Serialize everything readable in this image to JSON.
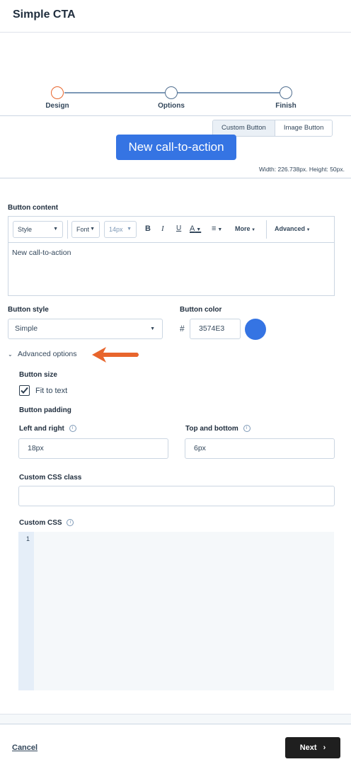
{
  "header": {
    "title": "Simple CTA"
  },
  "steps": [
    {
      "label": "Design",
      "active": true
    },
    {
      "label": "Options",
      "active": false
    },
    {
      "label": "Finish",
      "active": false
    }
  ],
  "button_type": {
    "custom": "Custom Button",
    "image": "Image Button",
    "selected": "Custom Button"
  },
  "preview": {
    "button_text": "New call-to-action",
    "dimensions": "Width: 226.738px. Height: 50px.",
    "button_color": "#3574E3"
  },
  "content": {
    "label": "Button content",
    "toolbar": {
      "style": "Style",
      "font": "Font",
      "size": "14px",
      "bold": "B",
      "italic": "I",
      "underline": "U",
      "text_color": "A",
      "more": "More",
      "advanced": "Advanced"
    },
    "text": "New call-to-action"
  },
  "style": {
    "label": "Button style",
    "value": "Simple"
  },
  "color": {
    "label": "Button color",
    "hash": "#",
    "value": "3574E3"
  },
  "advanced": {
    "toggle_label": "Advanced options",
    "size_label": "Button size",
    "fit_to_text_label": "Fit to text",
    "fit_to_text_checked": true,
    "padding_label": "Button padding",
    "left_right_label": "Left and right",
    "left_right_value": "18px",
    "top_bottom_label": "Top and bottom",
    "top_bottom_value": "6px",
    "css_class_label": "Custom CSS class",
    "css_class_value": "",
    "custom_css_label": "Custom CSS",
    "line_number": "1"
  },
  "footer": {
    "cancel": "Cancel",
    "next": "Next"
  },
  "colors": {
    "accent": "#e8652c",
    "primary": "#3574E3",
    "next_button": "#1f1f1f"
  }
}
